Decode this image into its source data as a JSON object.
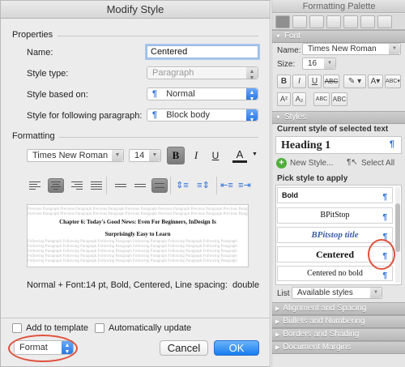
{
  "dialog": {
    "title": "Modify Style",
    "properties_heading": "Properties",
    "name_label": "Name:",
    "name_value": "Centered",
    "style_type_label": "Style type:",
    "style_type_value": "Paragraph",
    "based_on_label": "Style based on:",
    "based_on_value": "Normal",
    "following_label": "Style for following paragraph:",
    "following_value": "Block body",
    "formatting_heading": "Formatting",
    "font_name": "Times New Roman",
    "font_size": "14",
    "bold_label": "B",
    "italic_label": "I",
    "underline_label": "U",
    "color_label": "A",
    "preview": {
      "filler": "Previous Paragraph Previous Paragraph Previous Paragraph Previous Paragraph Previous Paragraph Previous Paragraph Previous Paragraph",
      "heading_line1": "Chapter 6: Today's Good News: Even For Beginners, InDesign Is",
      "heading_line2": "Surprisingly Easy to Learn",
      "following": "Following Paragraph Following Paragraph Following Paragraph Following Paragraph Following Paragraph Following Paragraph"
    },
    "description": "Normal + Font:14 pt, Bold, Centered, Line spacing:  double",
    "add_to_template_label": "Add to template",
    "auto_update_label": "Automatically update",
    "format_label": "Format",
    "cancel_label": "Cancel",
    "ok_label": "OK"
  },
  "palette": {
    "title": "Formatting Palette",
    "font_section": "Font",
    "name_label": "Name:",
    "font_name": "Times New Roman",
    "size_label": "Size:",
    "font_size": "16",
    "styles_section": "Styles",
    "current_style_label": "Current style of selected text",
    "current_style_value": "Heading 1",
    "new_style_label": "New Style...",
    "select_all_label": "Select All",
    "pick_style_label": "Pick style to apply",
    "style_items": [
      "Bold",
      "BPitStop",
      "BPitstop title",
      "Centered",
      "Centered no bold"
    ],
    "list_label": "List",
    "list_value": "Available styles",
    "collapsed_sections": [
      "Alignment and Spacing",
      "Bullets and Numbering",
      "Borders and Shading",
      "Document Margins"
    ]
  },
  "colors": {
    "accent_blue": "#2b77e2",
    "annotation_red": "#e0503c"
  }
}
